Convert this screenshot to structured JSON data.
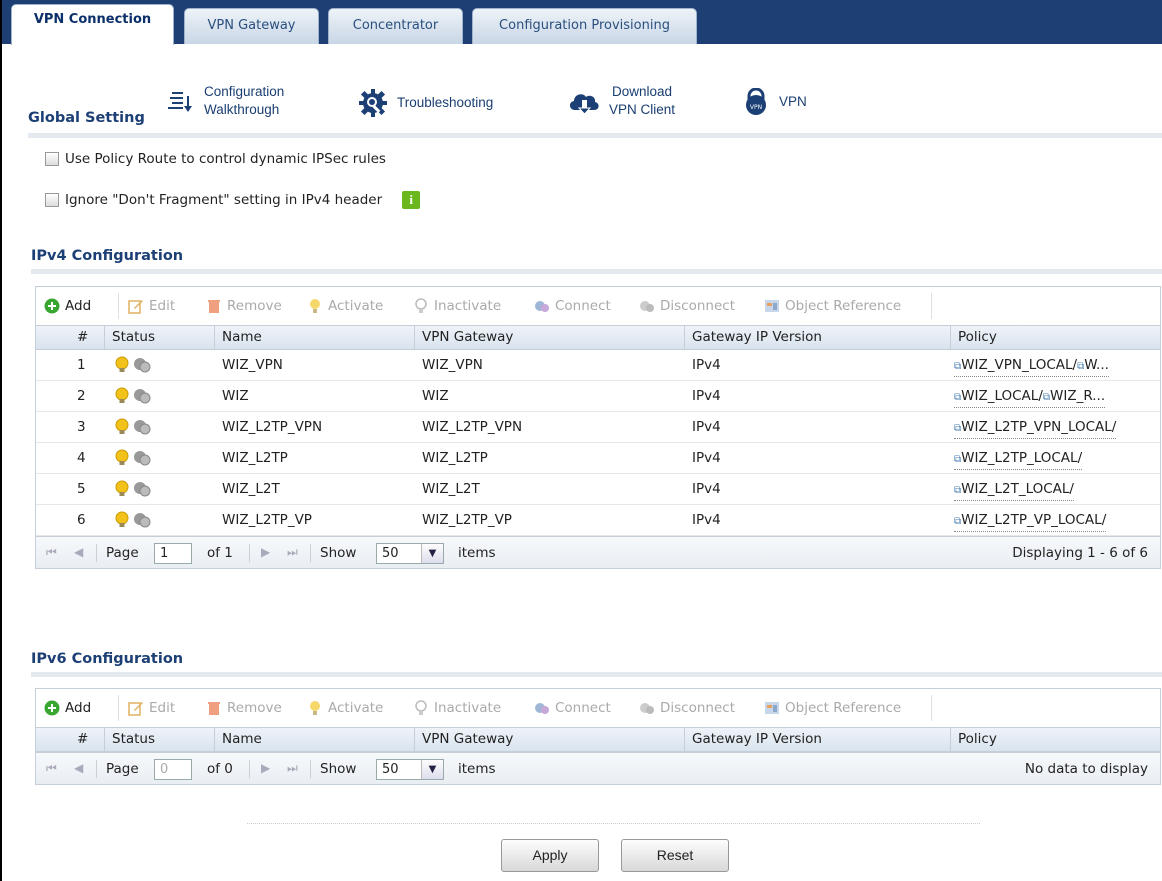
{
  "tabs": [
    {
      "label": "VPN Connection",
      "active": true
    },
    {
      "label": "VPN Gateway",
      "active": false
    },
    {
      "label": "Concentrator",
      "active": false
    },
    {
      "label": "Configuration Provisioning",
      "active": false
    }
  ],
  "global_setting": {
    "title": "Global Setting"
  },
  "quick_links": [
    {
      "line1": "Configuration",
      "line2": "Walkthrough",
      "icon": "walkthrough-icon"
    },
    {
      "line1": "Troubleshooting",
      "line2": "",
      "icon": "troubleshooting-gear-icon"
    },
    {
      "line1": "Download",
      "line2": "VPN Client",
      "icon": "cloud-download-icon"
    },
    {
      "line1": "VPN",
      "line2": "",
      "icon": "vpn-lock-icon"
    }
  ],
  "options": {
    "policy_route": {
      "label": "Use Policy Route to control dynamic IPSec rules",
      "checked": false
    },
    "ignore_df": {
      "label": "Ignore \"Don't Fragment\" setting in IPv4 header",
      "checked": false
    }
  },
  "toolbar": {
    "add": "Add",
    "edit": "Edit",
    "remove": "Remove",
    "activate": "Activate",
    "inactivate": "Inactivate",
    "connect": "Connect",
    "disconnect": "Disconnect",
    "object_reference": "Object Reference"
  },
  "columns": {
    "num": "#",
    "status": "Status",
    "name": "Name",
    "gateway": "VPN Gateway",
    "ipver": "Gateway IP Version",
    "policy": "Policy"
  },
  "ipv4": {
    "title": "IPv4 Configuration",
    "rows": [
      {
        "num": "1",
        "name": "WIZ_VPN",
        "gateway": "WIZ_VPN",
        "ipver": "IPv4",
        "policy": "WIZ_VPN_LOCAL/",
        "policy_remote": "W..."
      },
      {
        "num": "2",
        "name": "WIZ",
        "gateway": "WIZ",
        "ipver": "IPv4",
        "policy": "WIZ_LOCAL/",
        "policy_remote": "WIZ_R..."
      },
      {
        "num": "3",
        "name": "WIZ_L2TP_VPN",
        "gateway": "WIZ_L2TP_VPN",
        "ipver": "IPv4",
        "policy": "WIZ_L2TP_VPN_LOCAL/",
        "policy_remote": ""
      },
      {
        "num": "4",
        "name": "WIZ_L2TP",
        "gateway": "WIZ_L2TP",
        "ipver": "IPv4",
        "policy": "WIZ_L2TP_LOCAL/",
        "policy_remote": ""
      },
      {
        "num": "5",
        "name": "WIZ_L2T",
        "gateway": "WIZ_L2T",
        "ipver": "IPv4",
        "policy": "WIZ_L2T_LOCAL/",
        "policy_remote": ""
      },
      {
        "num": "6",
        "name": "WIZ_L2TP_VP",
        "gateway": "WIZ_L2TP_VP",
        "ipver": "IPv4",
        "policy": "WIZ_L2TP_VP_LOCAL/",
        "policy_remote": ""
      }
    ],
    "pager": {
      "page_label": "Page",
      "page": "1",
      "of_label": "of 1",
      "show_label": "Show",
      "per_page": "50",
      "items_label": "items",
      "status": "Displaying 1 - 6 of 6"
    }
  },
  "ipv6": {
    "title": "IPv6 Configuration",
    "pager": {
      "page_label": "Page",
      "page": "0",
      "of_label": "of 0",
      "show_label": "Show",
      "per_page": "50",
      "items_label": "items",
      "status": "No data to display"
    }
  },
  "buttons": {
    "apply": "Apply",
    "reset": "Reset"
  },
  "colors": {
    "tab_bar": "#1e3f74",
    "heading": "#1c3f75",
    "add_green": "#3aa632",
    "bulb_yellow": "#f2c21a"
  }
}
